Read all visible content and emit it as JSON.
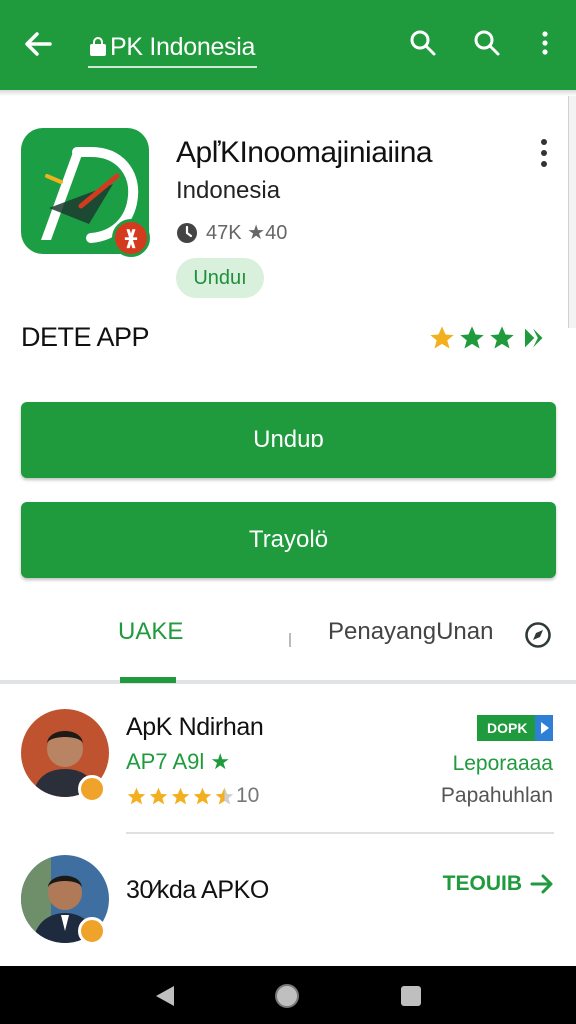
{
  "header": {
    "title": "PK Indonesia",
    "back_icon": "arrow-back-icon",
    "icons": [
      "search-icon",
      "search-icon",
      "more-vert-icon"
    ]
  },
  "app": {
    "name": "ApľKInoomajiniaiina",
    "developer": "Indonesia",
    "meta_text": "47K ★40",
    "chip_label": "Unduı",
    "badge_glyph": "ᚕ"
  },
  "section": {
    "title": "DETE APP",
    "rating_stars": 3.5
  },
  "buttons": {
    "primary_label": "Unduɒ",
    "secondary_label": "Trayolö"
  },
  "tabs": {
    "tab1_label": "UAKE",
    "tab2_label": "PenayangUnan",
    "tab2_icon": "compass-icon"
  },
  "list": [
    {
      "title": "ApK Ndirhan",
      "subtitle": "AP7 A9l ★",
      "rating_value": "10",
      "stars": 4.5,
      "tag_label": "DOPK",
      "right_line1": "Leporaaaa",
      "right_line2": "Papahuhlan"
    },
    {
      "title": "30⁄kda APKO",
      "link_label": "TEOUIB",
      "link_icon": "arrow-right-icon"
    }
  ],
  "colors": {
    "primary": "#1f9a3c",
    "star": "#f2b01e",
    "tag_accent": "#2f7fd6"
  },
  "system_nav": [
    "nav-back-icon",
    "nav-home-icon",
    "nav-recents-icon"
  ]
}
